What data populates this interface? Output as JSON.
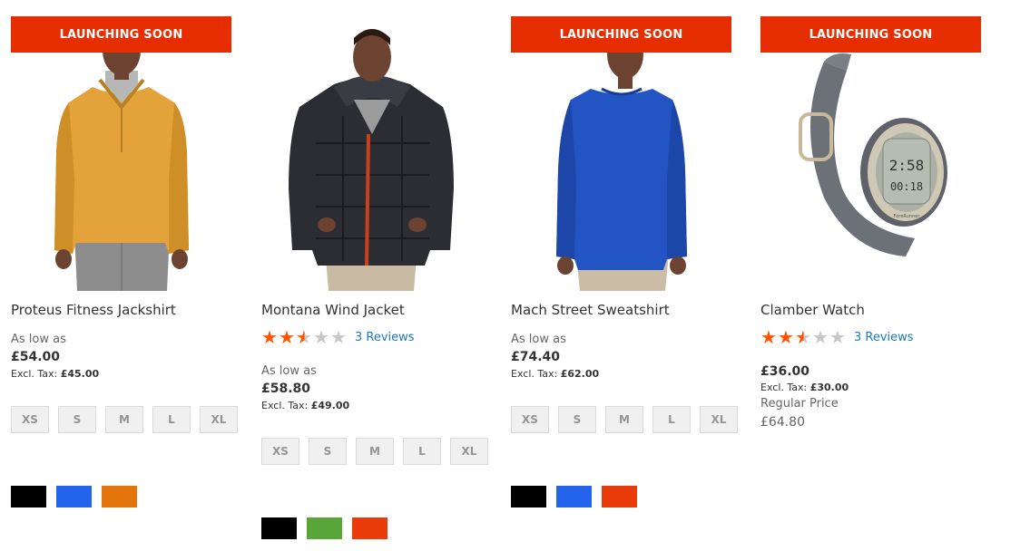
{
  "products": [
    {
      "badge": "LAUNCHING SOON",
      "image": "yellow-quarter-zip-jackshirt",
      "name": "Proteus Fitness Jackshirt",
      "as_low_as": "As low as",
      "price": "£54.00",
      "tax_label": "Excl. Tax:",
      "tax_value": "£45.00",
      "sizes": [
        "XS",
        "S",
        "M",
        "L",
        "XL"
      ],
      "colors": [
        "#000000",
        "#2463eb",
        "#e3740c"
      ]
    },
    {
      "badge": "",
      "image": "black-puffer-wind-jacket",
      "name": "Montana Wind Jacket",
      "rating": 2.5,
      "reviews": "3 Reviews",
      "as_low_as": "As low as",
      "price": "£58.80",
      "tax_label": "Excl. Tax:",
      "tax_value": "£49.00",
      "sizes": [
        "XS",
        "S",
        "M",
        "L",
        "XL"
      ],
      "colors": [
        "#000000",
        "#5aa53a",
        "#ea3c0a"
      ]
    },
    {
      "badge": "LAUNCHING SOON",
      "image": "blue-street-sweatshirt",
      "name": "Mach Street Sweatshirt",
      "as_low_as": "As low as",
      "price": "£74.40",
      "tax_label": "Excl. Tax:",
      "tax_value": "£62.00",
      "sizes": [
        "XS",
        "S",
        "M",
        "L",
        "XL"
      ],
      "colors": [
        "#000000",
        "#2463eb",
        "#ea3c0a"
      ]
    },
    {
      "badge": "LAUNCHING SOON",
      "image": "grey-digital-watch",
      "name": "Clamber Watch",
      "rating": 2.5,
      "reviews": "3 Reviews",
      "price": "£36.00",
      "tax_label": "Excl. Tax:",
      "tax_value": "£30.00",
      "regular_label": "Regular Price",
      "regular_price": "£64.80",
      "watch_display_top": "2:58",
      "watch_display_bottom": "00:18",
      "watch_brand": "ForeRunner",
      "sizes": [],
      "colors": []
    }
  ]
}
